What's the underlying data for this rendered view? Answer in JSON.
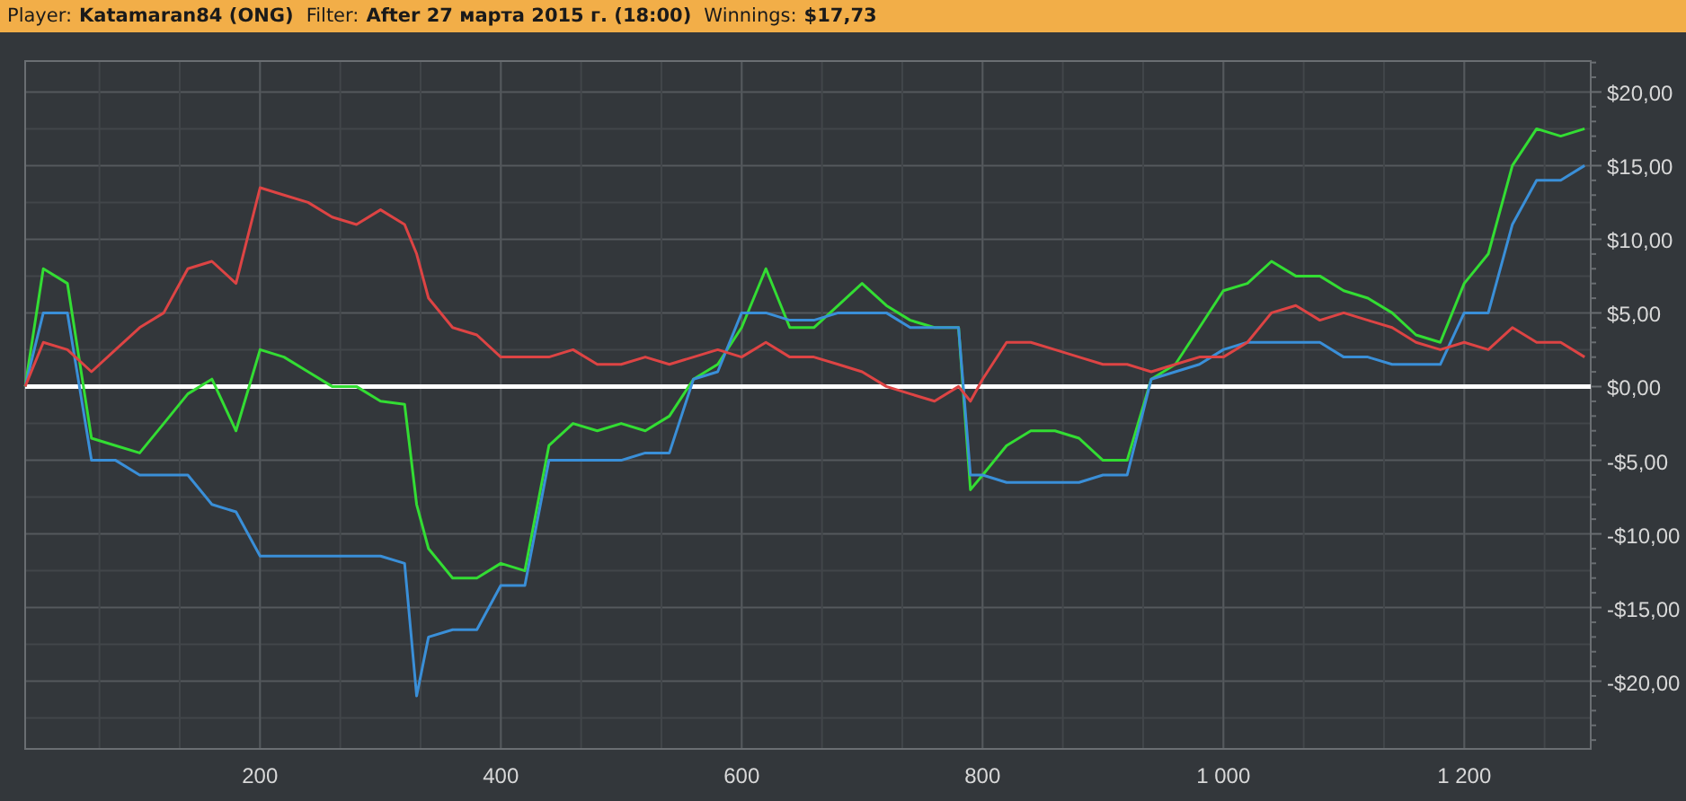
{
  "header": {
    "fields": [
      {
        "label": "Player:",
        "value": "Katamaran84 (ONG)"
      },
      {
        "label": "Filter:",
        "value": "After 27 марта 2015 г. (18:00)"
      },
      {
        "label": "Winnings:",
        "value": "$17,73"
      }
    ]
  },
  "chart": {
    "chart_data": {
      "type": "line",
      "grid": true,
      "x": [
        5,
        20,
        40,
        60,
        80,
        100,
        120,
        140,
        160,
        180,
        200,
        220,
        240,
        260,
        280,
        300,
        320,
        330,
        340,
        360,
        380,
        400,
        420,
        440,
        460,
        480,
        500,
        520,
        540,
        560,
        580,
        600,
        620,
        640,
        660,
        680,
        700,
        720,
        740,
        760,
        780,
        790,
        800,
        820,
        840,
        860,
        880,
        900,
        920,
        940,
        960,
        980,
        1000,
        1020,
        1040,
        1060,
        1080,
        1100,
        1120,
        1140,
        1160,
        1180,
        1200,
        1220,
        1240,
        1260,
        1280,
        1300
      ],
      "series": [
        {
          "color": "#33dd33",
          "values": [
            0,
            8,
            7,
            -3.5,
            -4,
            -4.5,
            -2.5,
            -0.5,
            0.5,
            -3,
            2.5,
            2,
            1,
            0,
            0,
            -1,
            -1.2,
            -8,
            -11,
            -13,
            -13,
            -12,
            -12.5,
            -4,
            -2.5,
            -3,
            -2.5,
            -3,
            -2,
            0.5,
            1.5,
            4,
            8,
            4,
            4,
            5.5,
            7,
            5.5,
            4.5,
            4,
            4,
            -7,
            -6,
            -4,
            -3,
            -3,
            -3.5,
            -5,
            -5,
            0.5,
            1.5,
            4,
            6.5,
            7,
            8.5,
            7.5,
            7.5,
            6.5,
            6,
            5,
            3.5,
            3,
            7,
            9,
            15,
            17.5,
            17,
            17.5
          ]
        },
        {
          "color": "#3a8fd8",
          "values": [
            0,
            5,
            5,
            -5,
            -5,
            -6,
            -6,
            -6,
            -8,
            -8.5,
            -11.5,
            -11.5,
            -11.5,
            -11.5,
            -11.5,
            -11.5,
            -12,
            -21,
            -17,
            -16.5,
            -16.5,
            -13.5,
            -13.5,
            -5,
            -5,
            -5,
            -5,
            -4.5,
            -4.5,
            0.5,
            1,
            5,
            5,
            4.5,
            4.5,
            5,
            5,
            5,
            4,
            4,
            4,
            -6,
            -6,
            -6.5,
            -6.5,
            -6.5,
            -6.5,
            -6,
            -6,
            0.5,
            1,
            1.5,
            2.5,
            3,
            3,
            3,
            3,
            2,
            2,
            1.5,
            1.5,
            1.5,
            5,
            5,
            11,
            14,
            14,
            15
          ]
        },
        {
          "color": "#dd4444",
          "values": [
            0,
            3,
            2.5,
            1,
            2.5,
            4,
            5,
            8,
            8.5,
            7,
            13.5,
            13,
            12.5,
            11.5,
            11,
            12,
            11,
            9,
            6,
            4,
            3.5,
            2,
            2,
            2,
            2.5,
            1.5,
            1.5,
            2,
            1.5,
            2,
            2.5,
            2,
            3,
            2,
            2,
            1.5,
            1,
            0,
            -0.5,
            -1,
            0,
            -1,
            0.5,
            3,
            3,
            2.5,
            2,
            1.5,
            1.5,
            1,
            1.5,
            2,
            2,
            3,
            5,
            5.5,
            4.5,
            5,
            4.5,
            4,
            3,
            2.5,
            3,
            2.5,
            4,
            3,
            3,
            2
          ]
        }
      ],
      "xlim": [
        5,
        1305
      ],
      "ylim": [
        -24.6,
        22.1
      ],
      "xticks": [
        200,
        400,
        600,
        800,
        {
          "value": 1000,
          "label": "1 000"
        },
        {
          "value": 1200,
          "label": "1 200"
        }
      ],
      "yticks": [
        {
          "value": 20,
          "label": "$20,00"
        },
        {
          "value": 15,
          "label": "$15,00"
        },
        {
          "value": 10,
          "label": "$10,00"
        },
        {
          "value": 5,
          "label": "$5,00"
        },
        {
          "value": 0,
          "label": "$0,00"
        },
        {
          "value": -5,
          "label": "-$5,00"
        },
        {
          "value": -10,
          "label": "-$10,00"
        },
        {
          "value": -15,
          "label": "-$15,00"
        },
        {
          "value": -20,
          "label": "-$20,00"
        }
      ]
    }
  }
}
